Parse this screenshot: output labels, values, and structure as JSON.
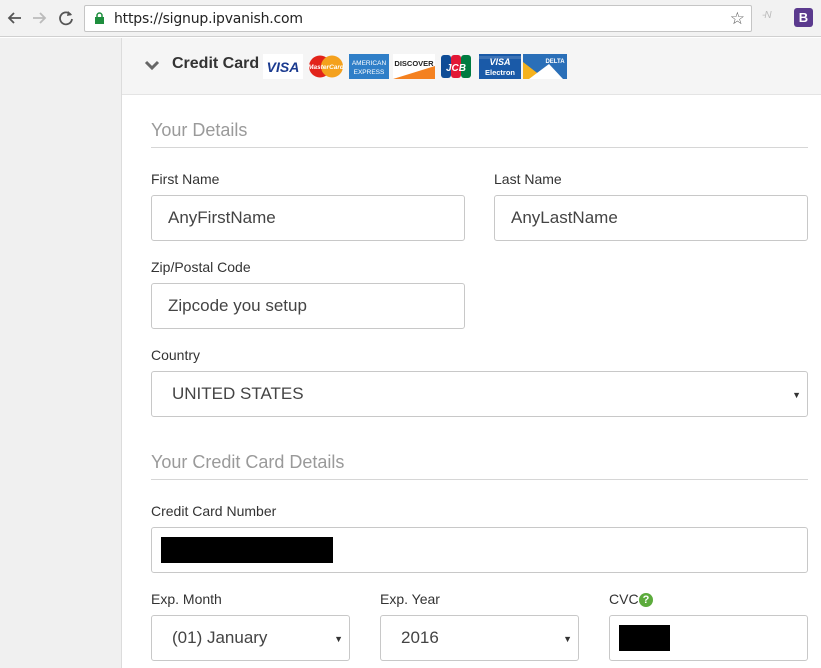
{
  "browser": {
    "url": "https://signup.ipvanish.com",
    "extension_b_label": "B",
    "extension_n_label": "-N"
  },
  "panel": {
    "title": "Credit Card",
    "card_logos": [
      {
        "name": "visa-logo",
        "text": "VISA"
      },
      {
        "name": "mastercard-logo",
        "text": "MasterCard"
      },
      {
        "name": "amex-logo",
        "text": "AMERICAN EXPRESS"
      },
      {
        "name": "discover-logo",
        "text": "DISCOVER"
      },
      {
        "name": "jcb-logo",
        "text": "JCB"
      },
      {
        "name": "visa-electron-logo",
        "text": "VISA Electron"
      },
      {
        "name": "delta-logo",
        "text": "DELTA"
      }
    ]
  },
  "your_details": {
    "title": "Your Details",
    "first_name_label": "First Name",
    "first_name_value": "AnyFirstName",
    "last_name_label": "Last Name",
    "last_name_value": "AnyLastName",
    "zip_label": "Zip/Postal Code",
    "zip_value": "Zipcode you setup",
    "country_label": "Country",
    "country_value": "UNITED STATES"
  },
  "card_details": {
    "title": "Your Credit Card Details",
    "card_number_label": "Credit Card Number",
    "exp_month_label": "Exp. Month",
    "exp_month_value": "(01) January",
    "exp_year_label": "Exp. Year",
    "exp_year_value": "2016",
    "cvc_label": "CVC"
  },
  "colors": {
    "help_icon": "#5cab3c",
    "lock": "#1e8e3e",
    "section_title": "#9a9a9a"
  }
}
